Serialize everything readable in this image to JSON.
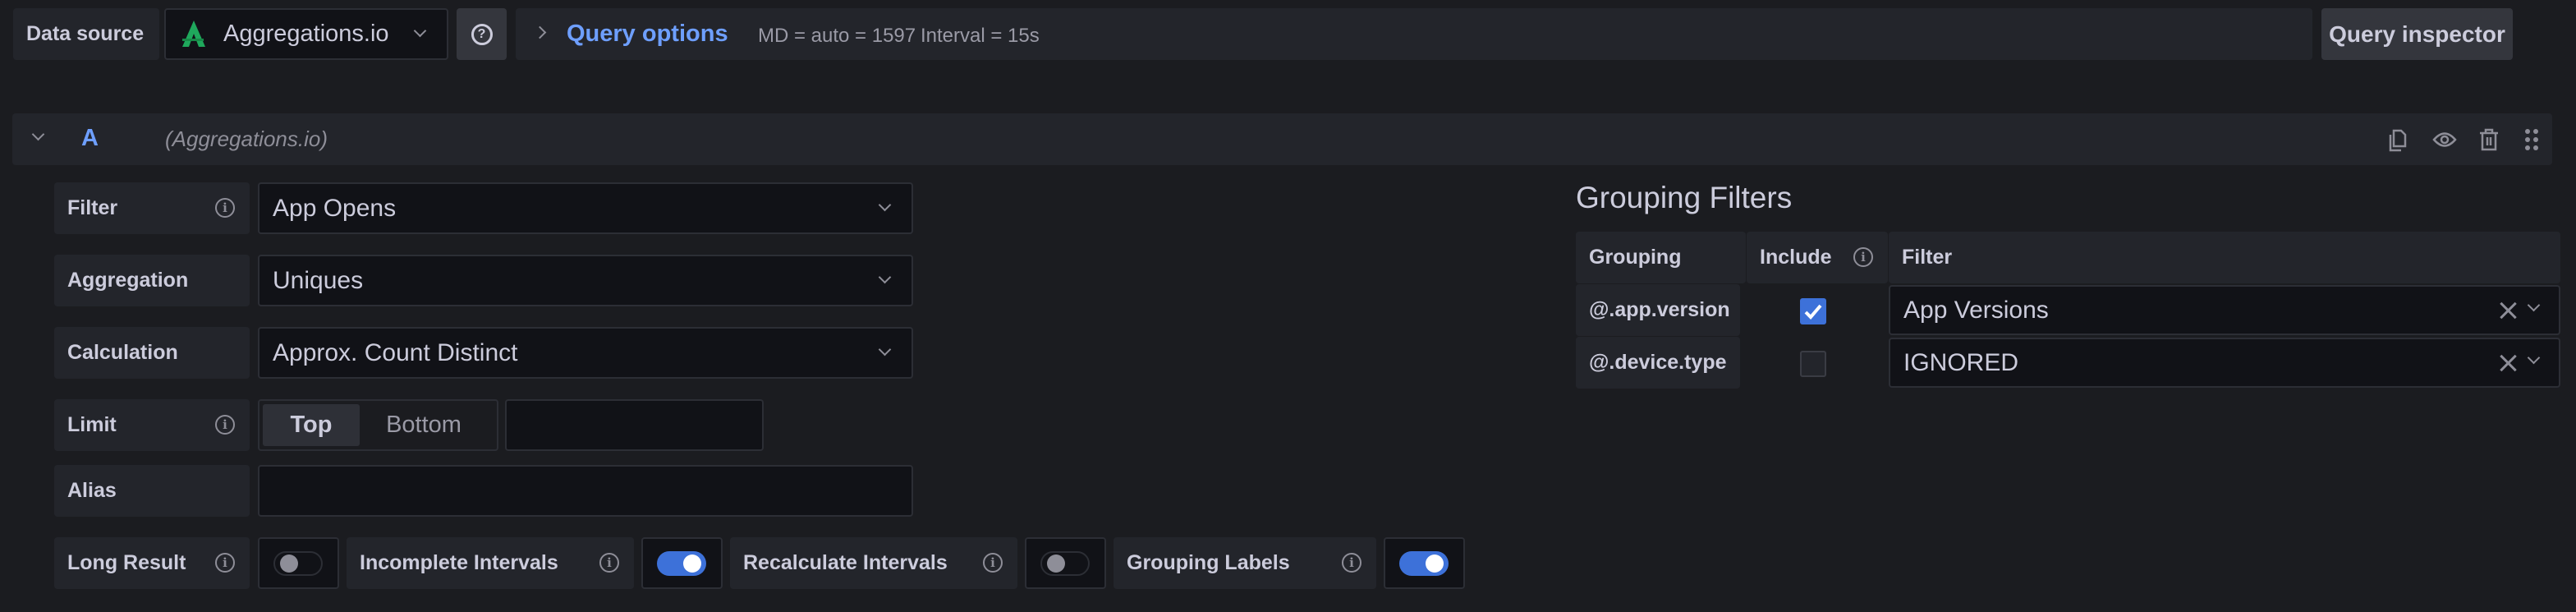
{
  "toolbar": {
    "data_source_label": "Data source",
    "data_source_value": "Aggregations.io",
    "help_icon": "question-circle-icon",
    "query_options_label": "Query options",
    "max_data_points": "MD = auto = 1597",
    "interval": "Interval = 15s",
    "query_inspector_label": "Query inspector"
  },
  "query": {
    "ref_id": "A",
    "datasource_name": "(Aggregations.io)",
    "actions": [
      "duplicate-icon",
      "eye-icon",
      "trash-icon",
      "drag-handle-icon"
    ]
  },
  "fields": {
    "filter": {
      "label": "Filter",
      "value": "App Opens"
    },
    "aggregation": {
      "label": "Aggregation",
      "value": "Uniques"
    },
    "calculation": {
      "label": "Calculation",
      "value": "Approx. Count Distinct"
    },
    "limit": {
      "label": "Limit",
      "options": [
        "Top",
        "Bottom"
      ],
      "selected": "Top",
      "value": ""
    },
    "alias": {
      "label": "Alias",
      "value": ""
    }
  },
  "toggles": {
    "long_result": {
      "label": "Long Result",
      "on": false
    },
    "incomplete_intervals": {
      "label": "Incomplete Intervals",
      "on": true
    },
    "recalculate_intervals": {
      "label": "Recalculate Intervals",
      "on": false
    },
    "grouping_labels": {
      "label": "Grouping Labels",
      "on": true
    }
  },
  "grouping_filters": {
    "title": "Grouping Filters",
    "headers": {
      "grouping": "Grouping",
      "include": "Include",
      "filter": "Filter"
    },
    "rows": [
      {
        "grouping": "@.app.version",
        "include": true,
        "filter": "App Versions"
      },
      {
        "grouping": "@.device.type",
        "include": false,
        "filter": "IGNORED"
      }
    ]
  },
  "colors": {
    "accent_blue": "#6e9fff",
    "toggle_on": "#3d71d9",
    "logo_green": "#1fa85c"
  }
}
